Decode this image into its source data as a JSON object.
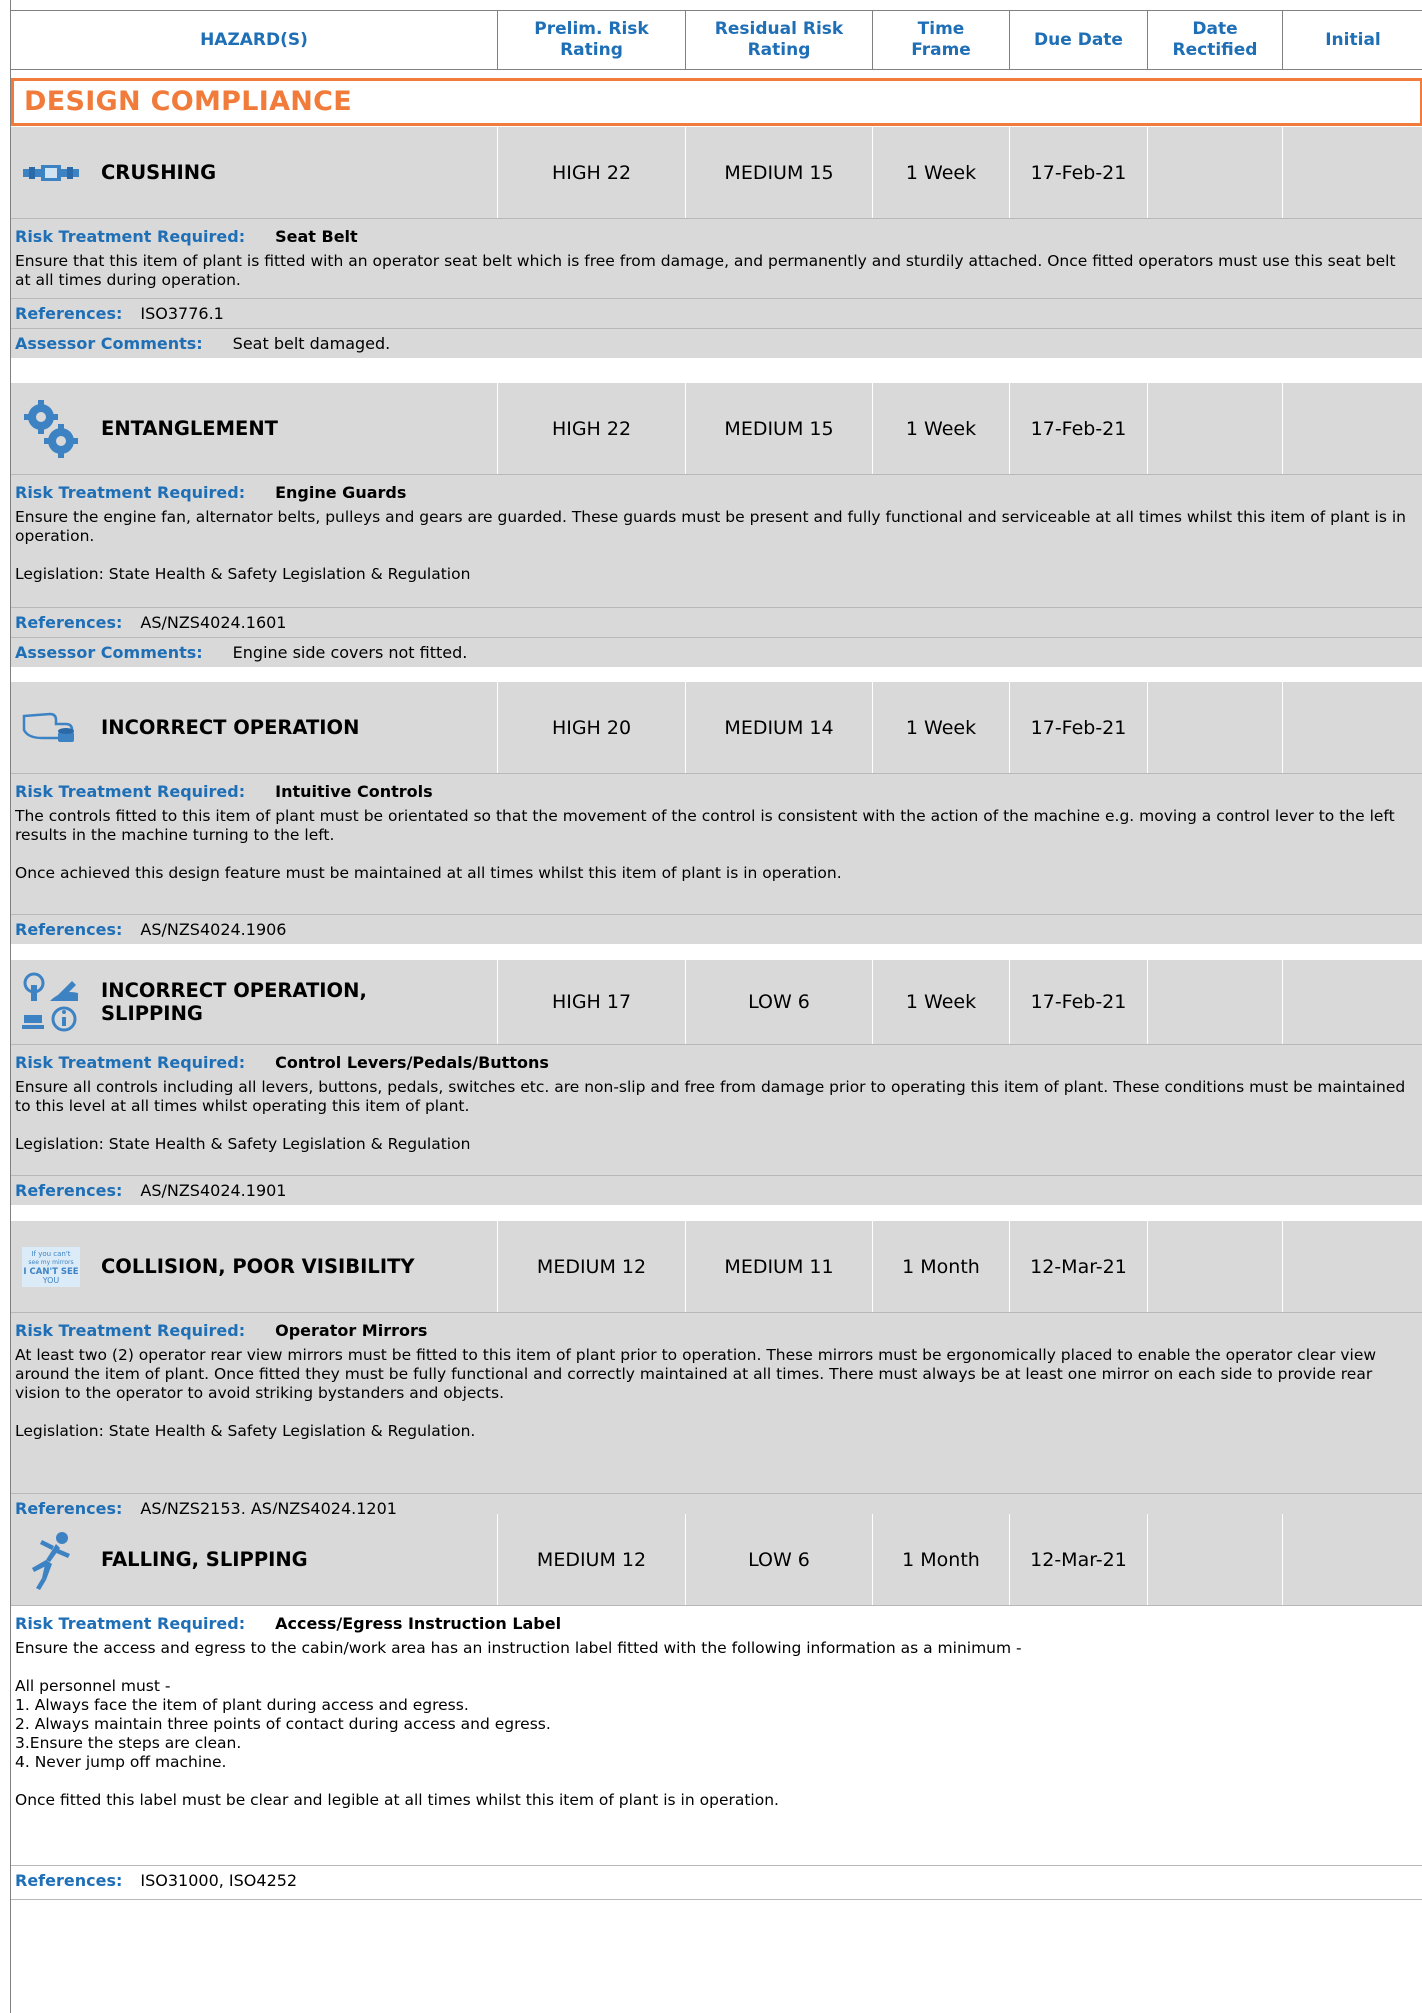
{
  "header": {
    "hazards": "HAZARD(S)",
    "prelim": "Prelim. Risk\nRating",
    "residual": "Residual Risk\nRating",
    "time": "Time\nFrame",
    "due": "Due Date",
    "rectified": "Date\nRectified",
    "initial": "Initial"
  },
  "section_title": "DESIGN COMPLIANCE",
  "labels": {
    "rtr": "Risk Treatment Required:",
    "refs": "References:",
    "assessor": "Assessor Comments:"
  },
  "hazards": [
    {
      "icon": "seatbelt-icon",
      "name": "CRUSHING",
      "prelim": "HIGH 22",
      "residual": "MEDIUM 15",
      "time": "1 Week",
      "due": "17-Feb-21",
      "rectified": "",
      "initial": "",
      "treatment": "Seat Belt",
      "description": "Ensure that this item of plant is fitted with an operator seat belt which is free from damage, and permanently and sturdily attached. Once fitted operators must use this seat belt at all times during operation.",
      "references": "ISO3776.1",
      "assessor": "Seat belt damaged."
    },
    {
      "icon": "gears-icon",
      "name": "ENTANGLEMENT",
      "prelim": "HIGH 22",
      "residual": "MEDIUM 15",
      "time": "1 Week",
      "due": "17-Feb-21",
      "rectified": "",
      "initial": "",
      "treatment": "Engine Guards",
      "description": "Ensure the engine fan, alternator belts, pulleys and gears are guarded. These guards must be present and fully functional and serviceable at all times whilst this item of plant is in operation.\n\nLegislation: State Health & Safety Legislation & Regulation",
      "references": "AS/NZS4024.1601",
      "assessor": "Engine side covers not fitted."
    },
    {
      "icon": "hand-control-icon",
      "name": "INCORRECT OPERATION",
      "prelim": "HIGH 20",
      "residual": "MEDIUM 14",
      "time": "1 Week",
      "due": "17-Feb-21",
      "rectified": "",
      "initial": "",
      "treatment": "Intuitive Controls",
      "description": "The controls fitted to this item of plant must be orientated so that the movement of the control is consistent with the action of the machine e.g. moving a control lever to the left results in the machine turning to the left.\n\nOnce achieved this design feature must be maintained at all times whilst this item of plant is in operation.",
      "references": "AS/NZS4024.1906",
      "assessor": ""
    },
    {
      "icon": "controls-icon",
      "name": "INCORRECT OPERATION,\nSLIPPING",
      "prelim": "HIGH 17",
      "residual": "LOW 6",
      "time": "1 Week",
      "due": "17-Feb-21",
      "rectified": "",
      "initial": "",
      "treatment": "Control Levers/Pedals/Buttons",
      "description": "Ensure all controls including all levers, buttons, pedals, switches etc. are non-slip and free from damage prior to operating this item of plant. These conditions must be maintained to this level at all times whilst operating this item of plant.\n\nLegislation: State Health & Safety Legislation & Regulation",
      "references": "AS/NZS4024.1901",
      "assessor": ""
    },
    {
      "icon": "mirror-sign-icon",
      "icon_text": "If you can't\nsee my mirrors\nI CAN'T SEE\nYOU",
      "name": "COLLISION, POOR VISIBILITY",
      "prelim": "MEDIUM 12",
      "residual": "MEDIUM 11",
      "time": "1 Month",
      "due": "12-Mar-21",
      "rectified": "",
      "initial": "",
      "treatment": "Operator Mirrors",
      "description": "At least two (2) operator rear view mirrors must be fitted to this item of plant prior to operation. These mirrors must be ergonomically placed to enable the operator clear view around the item of plant. Once fitted they must be fully functional and correctly maintained at all times. There must always be at least one mirror on each side to provide rear vision to the operator to avoid striking bystanders and objects.\n\nLegislation: State Health & Safety Legislation & Regulation.",
      "references": "AS/NZS2153, AS/NZS4024.1201",
      "assessor": ""
    },
    {
      "icon": "falling-person-icon",
      "name": "FALLING, SLIPPING",
      "prelim": "MEDIUM 12",
      "residual": "LOW 6",
      "time": "1 Month",
      "due": "12-Mar-21",
      "rectified": "",
      "initial": "",
      "treatment": "Access/Egress Instruction Label",
      "description": "Ensure the access and egress to the cabin/work area has an instruction label fitted with the following information as a minimum -\n\nAll personnel must  -\n1. Always face the item of plant during access and egress.\n2. Always maintain three points of contact during access and egress.\n3.Ensure the steps are clean.\n4. Never jump off machine.\n\nOnce fitted this label must be clear and legible at all times whilst this item of plant is in operation.",
      "references": "ISO31000, ISO4252",
      "assessor": ""
    }
  ]
}
